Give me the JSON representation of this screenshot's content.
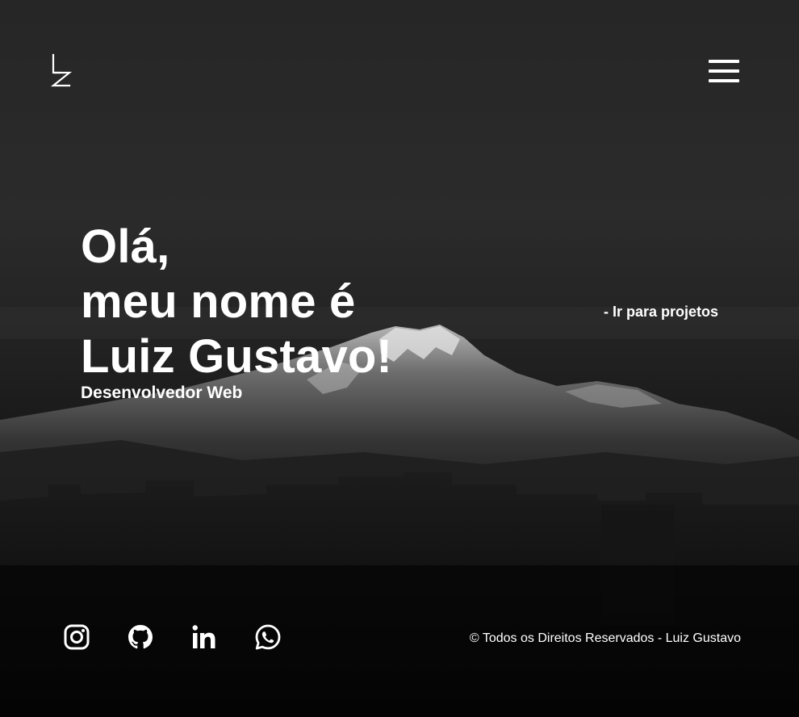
{
  "header": {
    "logo_icon": "lz-monogram-logo",
    "menu_icon": "hamburger-menu-icon"
  },
  "hero": {
    "line1": "Olá,",
    "line2": "meu nome é",
    "line3": "Luiz Gustavo!",
    "subtitle": "Desenvolvedor Web"
  },
  "projects_link": {
    "label": "- Ir para projetos"
  },
  "footer": {
    "social": [
      {
        "name": "Instagram",
        "icon": "instagram-icon"
      },
      {
        "name": "GitHub",
        "icon": "github-icon"
      },
      {
        "name": "LinkedIn",
        "icon": "linkedin-icon"
      },
      {
        "name": "WhatsApp",
        "icon": "whatsapp-icon"
      }
    ],
    "copyright": "© Todos os Direitos Reservados - Luiz Gustavo"
  },
  "colors": {
    "text": "#ffffff",
    "background": "#0a0a0a"
  }
}
